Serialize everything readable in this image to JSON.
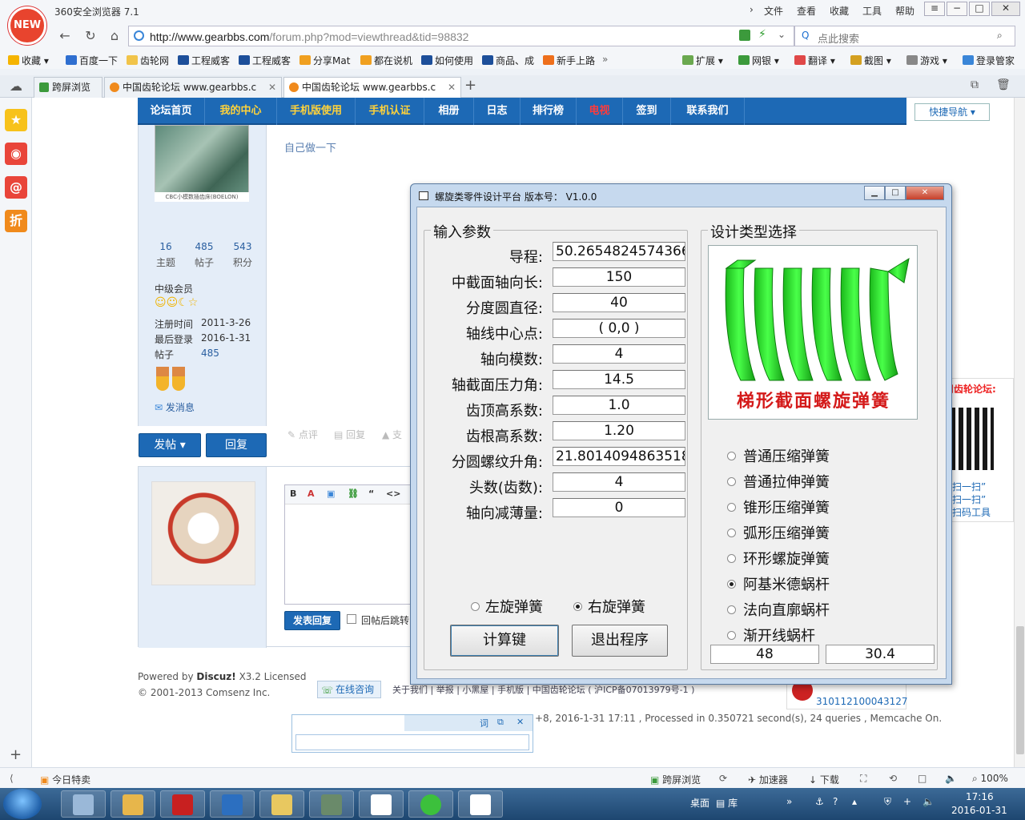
{
  "browser": {
    "logo_text": "NEW",
    "title": "360安全浏览器 7.1",
    "menu": [
      "文件",
      "查看",
      "收藏",
      "工具",
      "帮助"
    ],
    "url_host": "http://www.gearbbs.com",
    "url_path": "/forum.php?mod=viewthread&tid=98832",
    "search_placeholder": "点此搜索",
    "favorites": [
      "收藏",
      "百度一下",
      "齿轮网",
      "工程威客",
      "工程威客",
      "分享Mat",
      "都在说机",
      "如何使用",
      "商品、成",
      "新手上路"
    ],
    "toolbar_right": [
      "扩展",
      "网银",
      "翻译",
      "截图",
      "游戏",
      "登录管家"
    ],
    "tabs": [
      {
        "label": "跨屏浏览"
      },
      {
        "label": "中国齿轮论坛 www.gearbbs.c"
      },
      {
        "label": "中国齿轮论坛 www.gearbbs.c"
      }
    ]
  },
  "forum": {
    "nav": [
      "论坛首页",
      "我的中心",
      "手机版使用",
      "手机认证",
      "相册",
      "日志",
      "排行榜",
      "电视",
      "签到",
      "联系我们"
    ],
    "quick_nav": "快捷导航",
    "post_hint": "自己做一下",
    "avatar_caption": "CBC小模数插齿床(BOELON)",
    "stats": [
      {
        "num": "16",
        "label": "主题"
      },
      {
        "num": "485",
        "label": "帖子"
      },
      {
        "num": "543",
        "label": "积分"
      }
    ],
    "rank": "中级会员",
    "reg_label": "注册时间",
    "reg_value": "2011-3-26",
    "last_label": "最后登录",
    "last_value": "2016-1-31",
    "posts_label": "帖子",
    "posts_value": "485",
    "send_msg": "发消息",
    "post_actions": [
      "点评",
      "回复",
      "支"
    ],
    "btn_post": "发帖",
    "btn_reply": "回复",
    "btn_submit_reply": "发表回复",
    "jump_label": "回帖后跳转",
    "footer_powered": "Powered by",
    "footer_brand": "Discuz!",
    "footer_version": "X3.2 Licensed",
    "footer_copy": "© 2001-2013 Comsenz Inc.",
    "online_help": "在线咨询",
    "footer_links": "关于我们 | 举报 | 小黑屋 | 手机版 | 中国齿轮论坛 ( 沪ICP备07013979号-1 )",
    "processed": "+8, 2016-1-31 17:11 , Processed in 0.350721 second(s), 24 queries , Memcache On.",
    "police_num": "310112100043127",
    "qr_title": "用齿轮论坛:",
    "qr_lines": [
      "扫一扫”",
      "扫一扫”",
      "扫码工具"
    ],
    "dict_icons": [
      "词",
      "⧉",
      "✕"
    ]
  },
  "dialog": {
    "title": "螺旋类零件设计平台  版本号： V1.0.0",
    "input_group": "输入参数",
    "params": [
      {
        "label": "导程:",
        "value": "50.2654824574366"
      },
      {
        "label": "中截面轴向长:",
        "value": "150"
      },
      {
        "label": "分度圆直径:",
        "value": "40"
      },
      {
        "label": "轴线中心点:",
        "value": "( 0,0 )"
      },
      {
        "label": "轴向模数:",
        "value": "4"
      },
      {
        "label": "轴截面压力角:",
        "value": "14.5"
      },
      {
        "label": "齿顶高系数:",
        "value": "1.0"
      },
      {
        "label": "齿根高系数:",
        "value": "1.20"
      },
      {
        "label": "分圆螺纹升角:",
        "value": "21.8014094863518"
      },
      {
        "label": "头数(齿数):",
        "value": "4"
      },
      {
        "label": "轴向减薄量:",
        "value": "0"
      }
    ],
    "hand_left": "左旋弹簧",
    "hand_right": "右旋弹簧",
    "hand_selected": "right",
    "btn_calc": "计算键",
    "btn_exit": "退出程序",
    "type_group": "设计类型选择",
    "image_caption": "梯形截面螺旋弹簧",
    "types": [
      {
        "label": "普通压缩弹簧",
        "selected": false
      },
      {
        "label": "普通拉伸弹簧",
        "selected": false
      },
      {
        "label": "锥形压缩弹簧",
        "selected": false
      },
      {
        "label": "弧形压缩弹簧",
        "selected": false
      },
      {
        "label": "环形螺旋弹簧",
        "selected": false
      },
      {
        "label": "阿基米德蜗杆",
        "selected": true
      },
      {
        "label": "法向直廓蜗杆",
        "selected": false
      },
      {
        "label": "渐开线蜗杆",
        "selected": false
      }
    ],
    "out1": "48",
    "out2": "30.4"
  },
  "statusbar": {
    "left": "今日特卖",
    "items": [
      "跨屏浏览",
      "加速器",
      "下载"
    ],
    "zoom": "100%"
  },
  "taskbar": {
    "desktop": "桌面",
    "lib": "库",
    "time": "17:16",
    "date": "2016-01-31"
  },
  "colors": {
    "nav_blue": "#1d69b5",
    "spring_green": "#2fe02f",
    "caption_red": "#d41a1a"
  }
}
